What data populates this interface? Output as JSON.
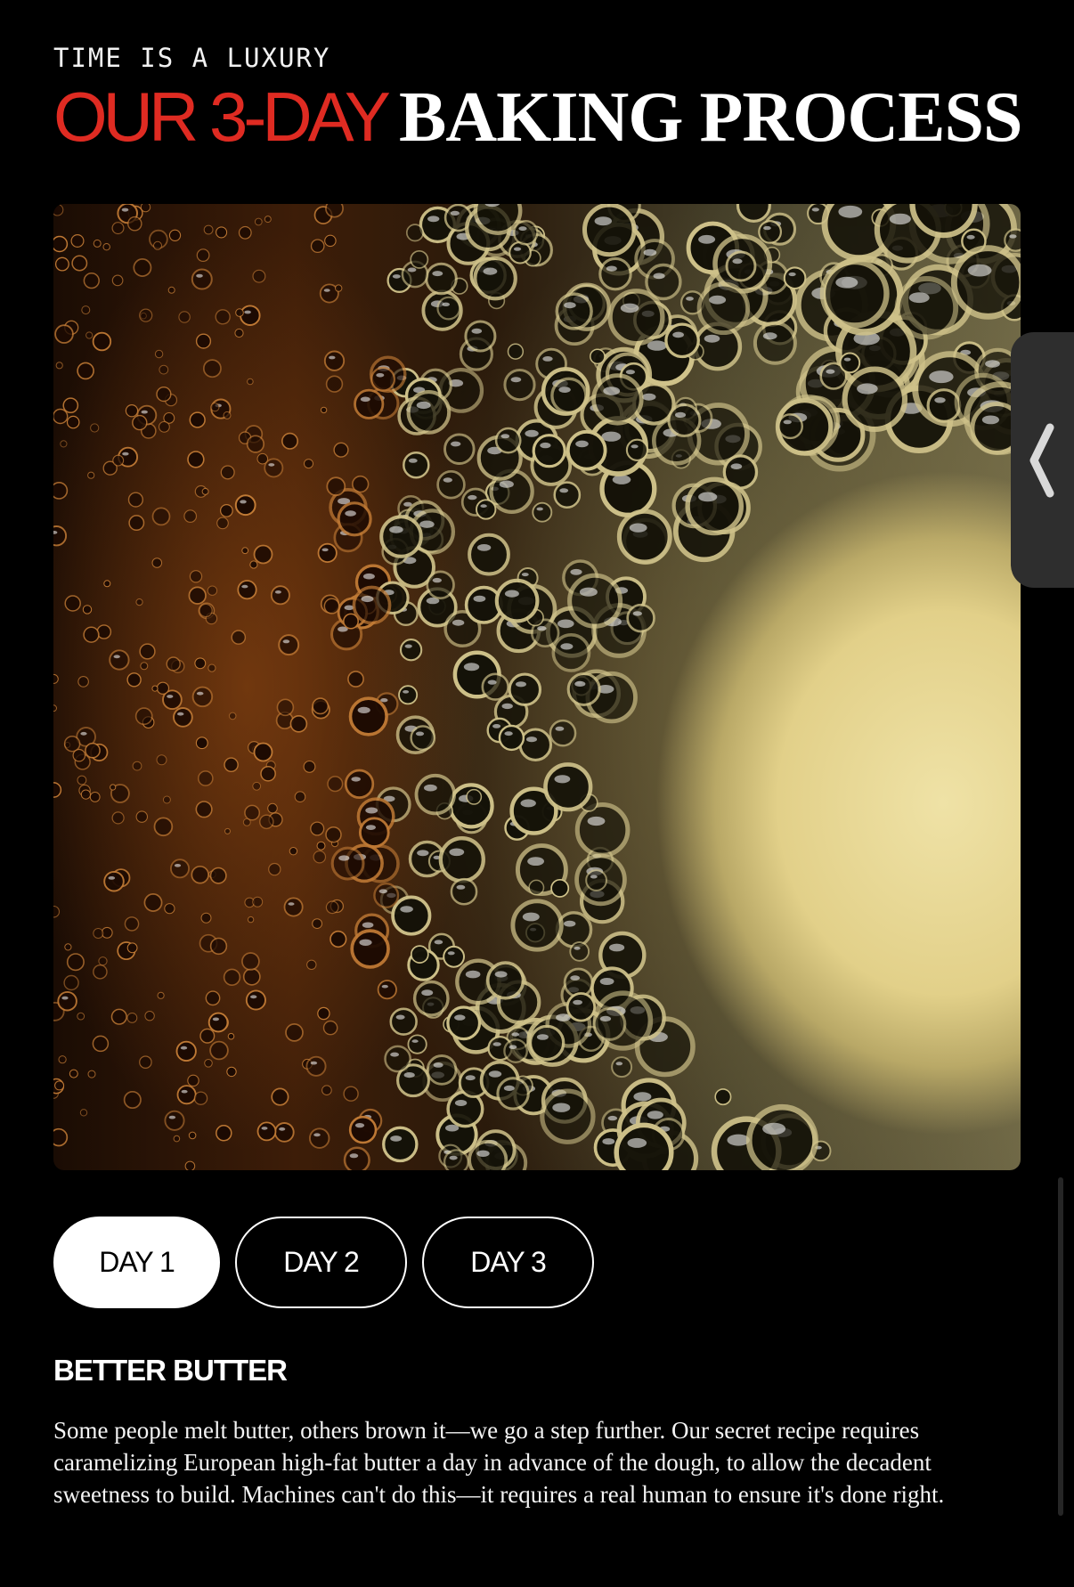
{
  "header": {
    "eyebrow": "TIME IS A LUXURY",
    "headline_accent": "OUR 3-DAY",
    "headline_main": "BAKING PROCESS"
  },
  "colors": {
    "background": "#000000",
    "accent_red": "#df2b22",
    "text": "#ffffff",
    "handle": "#2e2e2e"
  },
  "carousel": {
    "prev_icon": "chevron-left-icon"
  },
  "tabs": [
    {
      "label": "DAY 1",
      "active": true
    },
    {
      "label": "DAY 2",
      "active": false
    },
    {
      "label": "DAY 3",
      "active": false
    }
  ],
  "content": {
    "title": "BETTER BUTTER",
    "body": "Some people melt butter, others brown it—we go a step further. Our secret recipe requires caramelizing European high-fat butter a day in advance of the dough, to allow the decadent sweetness to build. Machines can't do this—it requires a real human to ensure it's done right."
  }
}
